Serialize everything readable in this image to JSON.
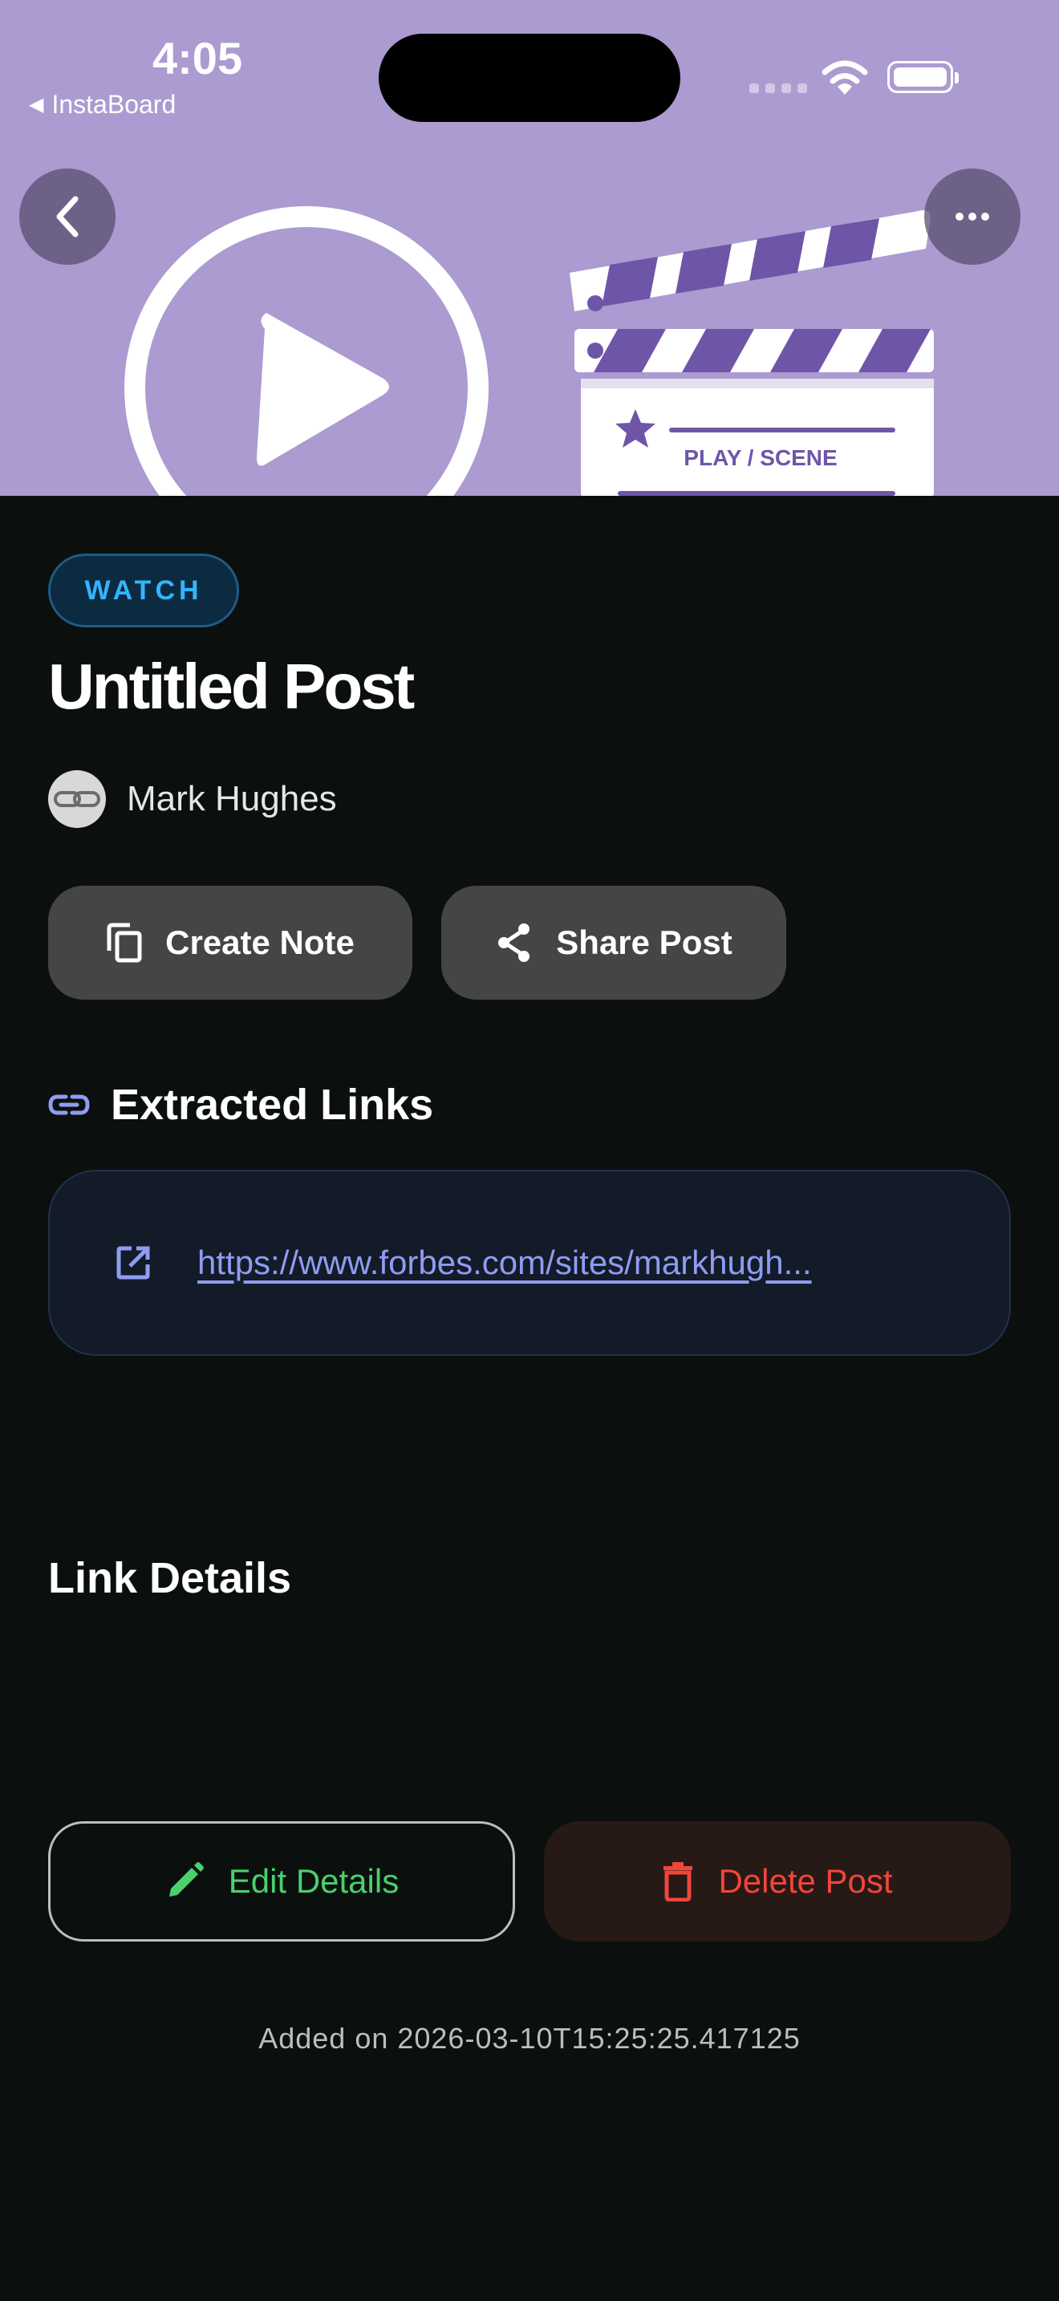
{
  "status_bar": {
    "time": "4:05",
    "back_app": "InstaBoard"
  },
  "hero": {
    "clapper_text": "PLAY / SCENE"
  },
  "post": {
    "tag": "WATCH",
    "title": "Untitled Post",
    "author": "Mark Hughes"
  },
  "actions": {
    "create_note": "Create Note",
    "share_post": "Share Post"
  },
  "extracted_links": {
    "heading": "Extracted Links",
    "links": [
      "https://www.forbes.com/sites/markhugh..."
    ]
  },
  "link_details": {
    "heading": "Link Details"
  },
  "footer_actions": {
    "edit": "Edit Details",
    "delete": "Delete Post"
  },
  "added_on": "Added on 2026-03-10T15:25:25.417125",
  "colors": {
    "background": "#0b100e",
    "hero": "#ab9bd1",
    "tag_text": "#34b4ff",
    "link": "#8f9cf2",
    "edit": "#4bd06d",
    "delete": "#f0463a"
  }
}
